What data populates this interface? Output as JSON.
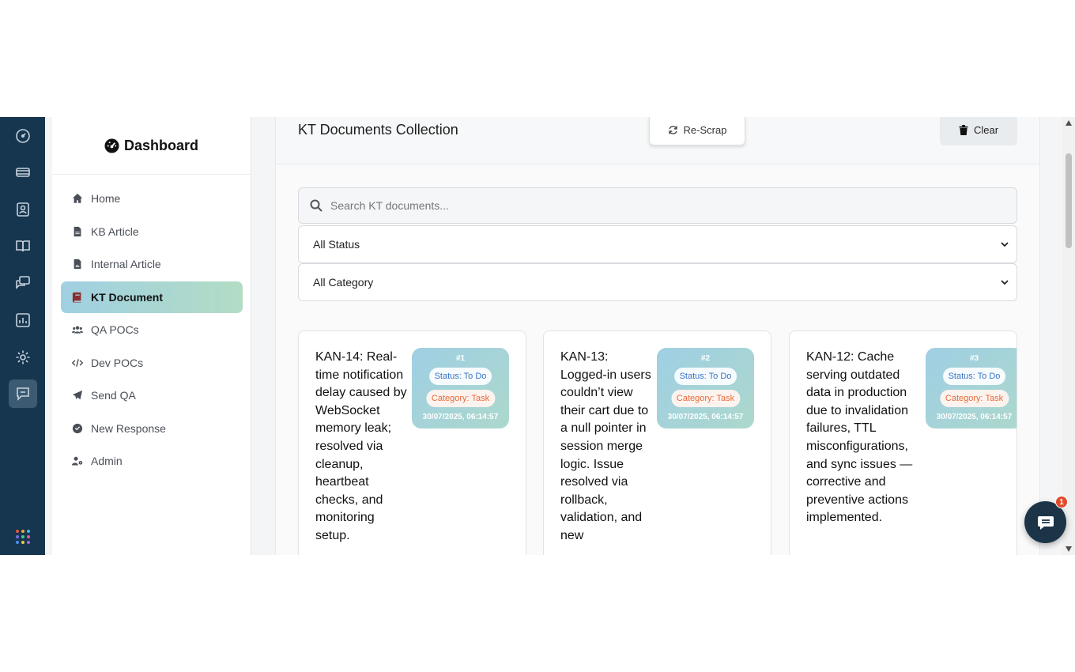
{
  "sidebar": {
    "brand": "Dashboard",
    "items": [
      {
        "label": "Home",
        "icon": "home-icon"
      },
      {
        "label": "KB Article",
        "icon": "file-icon"
      },
      {
        "label": "Internal Article",
        "icon": "file-image-icon"
      },
      {
        "label": "KT Document",
        "icon": "book-icon",
        "active": true
      },
      {
        "label": "QA POCs",
        "icon": "users-icon"
      },
      {
        "label": "Dev POCs",
        "icon": "code-icon"
      },
      {
        "label": "Send QA",
        "icon": "paper-plane-icon"
      },
      {
        "label": "New Response",
        "icon": "check-circle-icon"
      },
      {
        "label": "Admin",
        "icon": "user-cog-icon"
      }
    ]
  },
  "header": {
    "title": "KT Documents Collection",
    "rescrap_label": "Re-Scrap",
    "clear_label": "Clear"
  },
  "search": {
    "placeholder": "Search KT documents..."
  },
  "filters": {
    "status_value": "All Status",
    "category_value": "All Category"
  },
  "documents": [
    {
      "title": "KAN-14: Real-time notification delay caused by WebSocket memory leak; resolved via cleanup, heartbeat checks, and monitoring setup.",
      "num": "#1",
      "status": "Status: To Do",
      "category": "Category: Task",
      "date": "30/07/2025, 06:14:57"
    },
    {
      "title": "KAN-13: Logged-in users couldn’t view their cart due to a null pointer in session merge logic. Issue resolved via rollback, validation, and new",
      "num": "#2",
      "status": "Status: To Do",
      "category": "Category: Task",
      "date": "30/07/2025, 06:14:57"
    },
    {
      "title": "KAN-12: Cache serving outdated data in production due to invalidation failures, TTL misconfigurations, and sync issues — corrective and preventive actions implemented.",
      "num": "#3",
      "status": "Status: To Do",
      "category": "Category: Task",
      "date": "30/07/2025, 06:14:57"
    }
  ],
  "chat": {
    "badge": "1"
  },
  "colors": {
    "rail_bg": "#16364f",
    "active_gradient_start": "#9fd0e2",
    "active_gradient_end": "#b3dcc4",
    "status_text": "#3a73c4",
    "category_text": "#e76a3a",
    "badge": "#e24a2a"
  }
}
